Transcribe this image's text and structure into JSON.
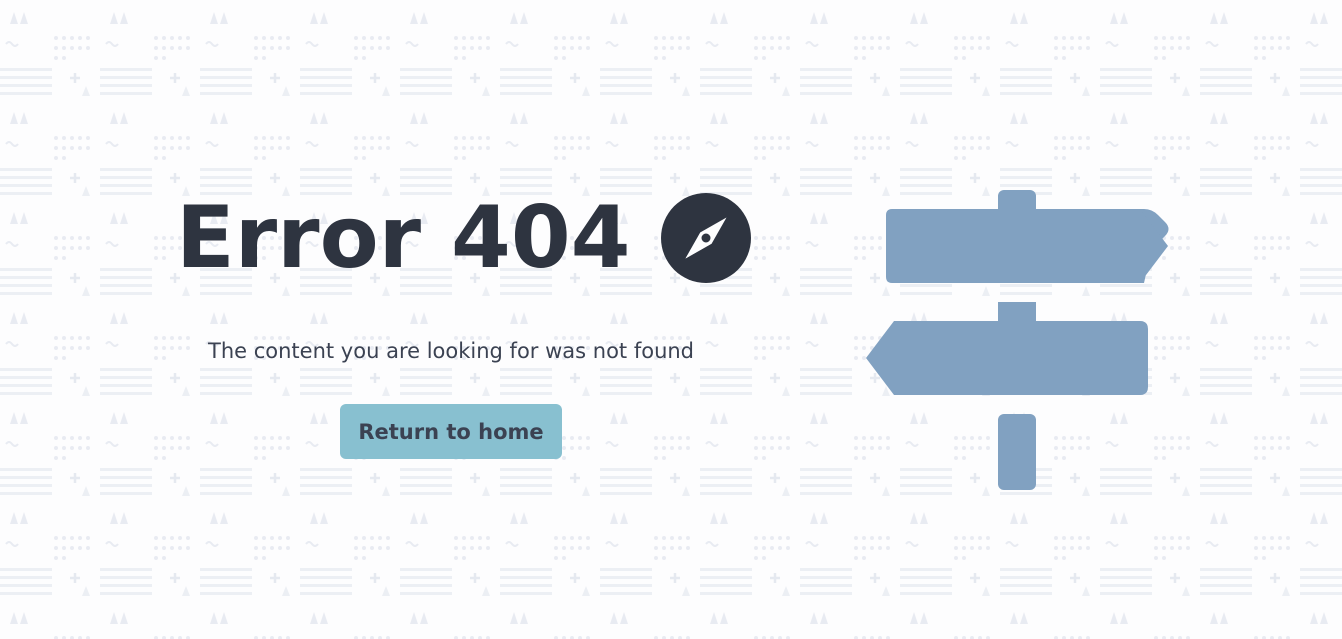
{
  "error": {
    "title": "Error 404",
    "message": "The content you are looking for was not found",
    "home_button_label": "Return to home"
  },
  "icons": {
    "title_icon": "compass-icon",
    "illustration": "signpost-icon"
  },
  "colors": {
    "text_dark": "#2e3440",
    "text_body": "#3b4252",
    "button_bg": "#88c0d0",
    "signpost": "#81a1c1",
    "background": "#fdfdfe",
    "pattern": "#eceff4"
  }
}
